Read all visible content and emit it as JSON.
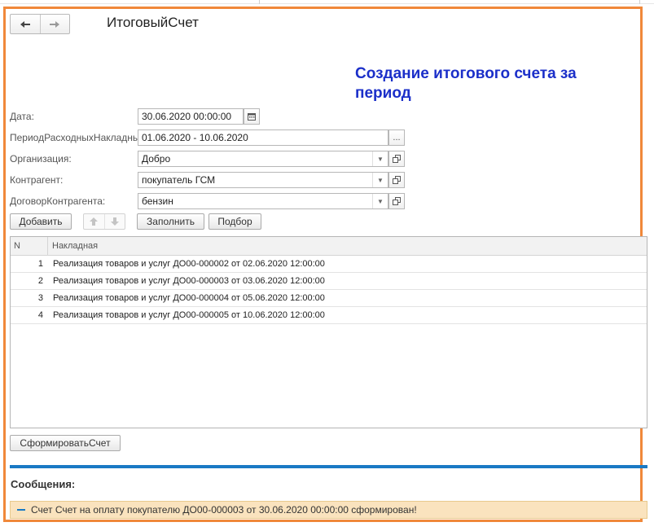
{
  "nav": {
    "back_icon": "arrow-left-icon",
    "forward_icon": "arrow-right-icon"
  },
  "form": {
    "title": "ИтоговыйСчет"
  },
  "annotation": "Создание итогового счета за период",
  "fields": {
    "date": {
      "label": "Дата:",
      "value": "30.06.2020 00:00:00"
    },
    "period": {
      "label": "ПериодРасходныхНакладных:",
      "value": "01.06.2020 - 10.06.2020",
      "button": "..."
    },
    "organization": {
      "label": "Организация:",
      "value": "Добро"
    },
    "counterparty": {
      "label": "Контрагент:",
      "value": "покупатель ГСМ"
    },
    "contract": {
      "label": "ДоговорКонтрагента:",
      "value": "бензин"
    }
  },
  "toolbar": {
    "add": "Добавить",
    "fill": "Заполнить",
    "select": "Подбор"
  },
  "table": {
    "columns": [
      "N",
      "Накладная"
    ],
    "rows": [
      {
        "n": "1",
        "doc": "Реализация товаров и услуг ДО00-000002 от 02.06.2020 12:00:00"
      },
      {
        "n": "2",
        "doc": "Реализация товаров и услуг ДО00-000003 от 03.06.2020 12:00:00"
      },
      {
        "n": "3",
        "doc": "Реализация товаров и услуг ДО00-000004 от 05.06.2020 12:00:00"
      },
      {
        "n": "4",
        "doc": "Реализация товаров и услуг ДО00-000005 от 10.06.2020 12:00:00"
      }
    ]
  },
  "generate_button": "СформироватьСчет",
  "messages": {
    "title": "Сообщения:",
    "items": [
      "Счет Счет на оплату покупателю ДО00-000003 от 30.06.2020 00:00:00 сформирован!"
    ]
  },
  "colors": {
    "frame": "#f0883a",
    "annotation": "#1b2fc9",
    "accent_bar": "#1979c4",
    "message_bg": "#fae3be"
  }
}
